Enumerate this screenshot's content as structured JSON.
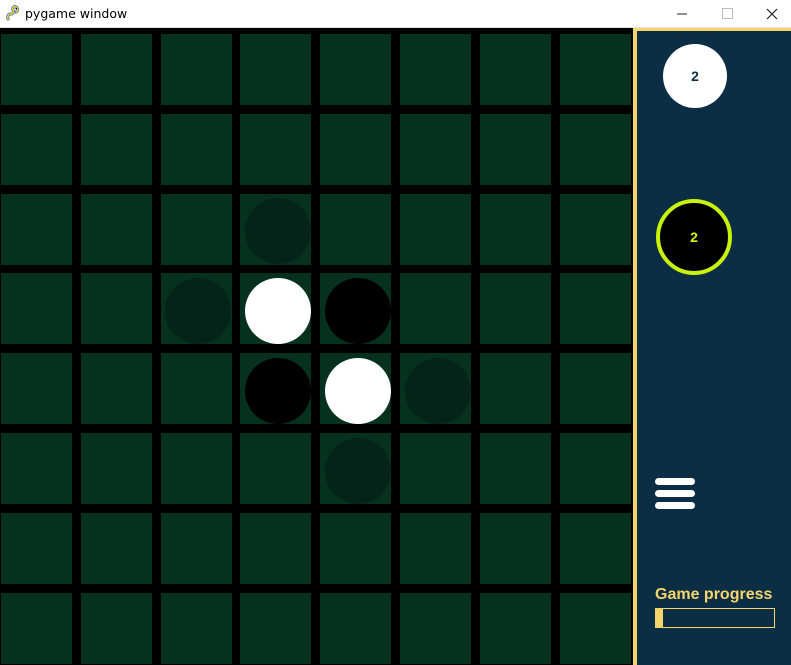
{
  "window": {
    "title": "pygame window",
    "icons": [
      "pygame-snake-icon",
      "minimize-icon",
      "maximize-icon",
      "close-icon"
    ]
  },
  "board": {
    "size": 8,
    "colors": {
      "cell": "#06301f",
      "grid": "#000000",
      "hint": "#04241a"
    },
    "pieces": [
      {
        "row": 3,
        "col": 3,
        "color": "white"
      },
      {
        "row": 3,
        "col": 4,
        "color": "black"
      },
      {
        "row": 4,
        "col": 3,
        "color": "black"
      },
      {
        "row": 4,
        "col": 4,
        "color": "white"
      }
    ],
    "hints": [
      {
        "row": 2,
        "col": 3
      },
      {
        "row": 3,
        "col": 2
      },
      {
        "row": 4,
        "col": 5
      },
      {
        "row": 5,
        "col": 4
      }
    ]
  },
  "panel": {
    "white_score": "2",
    "black_score": "2",
    "active_player": "black",
    "menu_icon": "hamburger-menu-icon",
    "progress_label": "Game progress",
    "progress_fraction": 0.06,
    "colors": {
      "background": "#0c2e44",
      "accent": "#f4d56b",
      "active_ring": "#c9f20b"
    }
  }
}
